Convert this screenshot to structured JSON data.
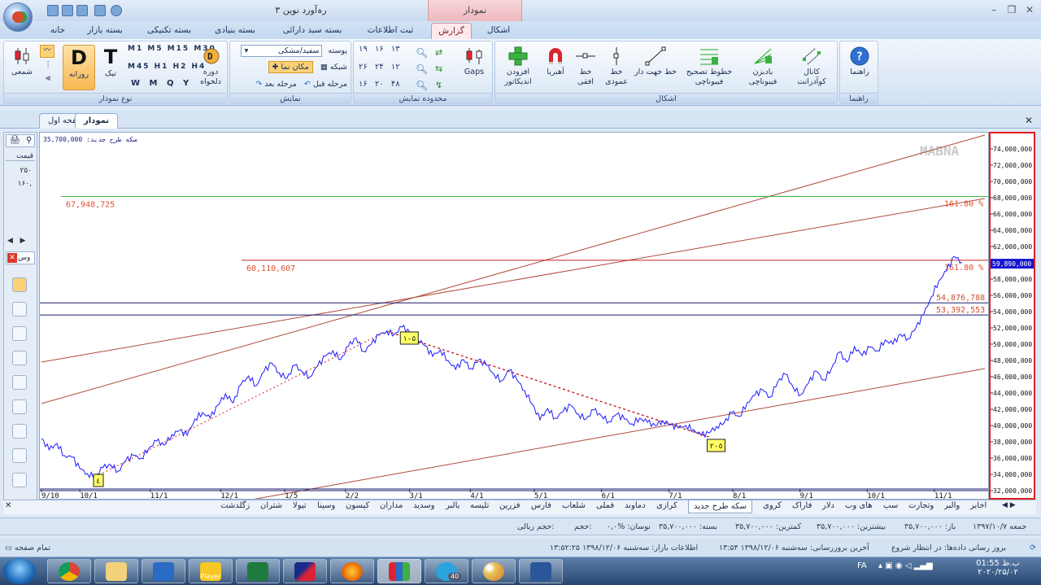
{
  "window": {
    "title": "رہ‌آورد نوین ۳",
    "context_tab_title": "نمودار"
  },
  "ribbon_tabs": [
    {
      "label": "خانه",
      "active": false
    },
    {
      "label": "بسته بازار",
      "active": false
    },
    {
      "label": "بسته تکنیکی",
      "active": false
    },
    {
      "label": "بسته بنیادی",
      "active": false
    },
    {
      "label": "بسته سبد دارائی",
      "active": false
    },
    {
      "label": "ثبت اطلاعات",
      "active": false
    },
    {
      "label": "گزارش",
      "active": true
    },
    {
      "label": "اشکال",
      "active": false
    }
  ],
  "groups": {
    "chart_type": {
      "label": "نوع نمودار",
      "candle": "شمعی",
      "daily": "روزانه",
      "tick": "تیک",
      "period": "دوره دلخواه",
      "period_letters": {
        "m1": "M1",
        "m5": "M5",
        "m15": "M15",
        "m30": "M30",
        "m45": "M45",
        "h1": "H1",
        "h2": "H2",
        "h4": "H4",
        "w": "W",
        "mo": "M",
        "q": "Q",
        "y": "Y"
      },
      "big_d": "D",
      "big_t": "T"
    },
    "view": {
      "label": "نمایش",
      "skin_label": "پوسته",
      "skin_value": "سفید/مشکی",
      "grid": "شبکه",
      "cursor": "مکان نما",
      "prev": "مرحله قبل",
      "next": "مرحله بعد"
    },
    "range": {
      "label": "محدوده نمایش",
      "row1": [
        "۱۹",
        "۱۶",
        "۱۳"
      ],
      "row2": [
        "۲۶",
        "۲۴",
        "۱۲"
      ],
      "row3": [
        "۱۶",
        "۲۰",
        "۴۸"
      ],
      "gaps": "Gaps"
    },
    "shapes": {
      "label": "اشکال",
      "add_indicator": "افزودن اندیکاتور",
      "magnet": "آهنربا",
      "hline": "خط افقی",
      "vline": "خط عمودی",
      "trend": "خط جهت دار",
      "fib_retr": "خطوط تصحیح فیبوناچی",
      "fib_fan": "بادبزن فیبوناچی",
      "channel": "کانال کوآدرانت"
    },
    "help": {
      "label": "راهنما",
      "button": "راهنما"
    }
  },
  "doc_tabs": [
    {
      "label": "نمودار",
      "active": true
    },
    {
      "label": "صفحه اول",
      "active": false
    }
  ],
  "left_panel": {
    "header": "قیمت",
    "rows": [
      "۲۵۰",
      "۱۶۰,"
    ],
    "search_label": "وس"
  },
  "chart_data": {
    "type": "line",
    "symbol_label": "سکه طرح جدید: 35,700,000",
    "watermark": "MABNA",
    "x_ticks": [
      "9/10",
      "10/1",
      "11/1",
      "12/1",
      "1/5",
      "2/2",
      "3/1",
      "4/1",
      "5/1",
      "6/1",
      "7/1",
      "8/1",
      "9/1",
      "10/1",
      "11/1",
      "12/1"
    ],
    "y_ticks": [
      "74,000,000",
      "72,000,000",
      "70,000,000",
      "68,000,000",
      "66,000,000",
      "64,000,000",
      "62,000,000",
      "60,000,000",
      "58,000,000",
      "56,000,000",
      "54,000,000",
      "52,000,000",
      "50,000,000",
      "48,000,000",
      "46,000,000",
      "44,000,000",
      "42,000,000",
      "40,000,000",
      "38,000,000",
      "36,000,000",
      "34,000,000",
      "32,000,000"
    ],
    "ylim": [
      30800000,
      75800000
    ],
    "last_price": "59,890,000",
    "series_color": "#1a1aff",
    "price_series": [
      [
        0,
        38200000
      ],
      [
        2,
        36800000
      ],
      [
        4,
        37600000
      ],
      [
        6,
        36100000
      ],
      [
        8,
        35900000
      ],
      [
        10,
        34500000
      ],
      [
        12,
        33900000
      ],
      [
        14,
        33500000
      ],
      [
        16,
        34600000
      ],
      [
        18,
        35000000
      ],
      [
        20,
        34200000
      ],
      [
        22,
        35500000
      ],
      [
        24,
        36100000
      ],
      [
        26,
        35800000
      ],
      [
        28,
        37000000
      ],
      [
        30,
        37900000
      ],
      [
        32,
        37400000
      ],
      [
        34,
        38700000
      ],
      [
        36,
        39200000
      ],
      [
        38,
        38600000
      ],
      [
        40,
        40600000
      ],
      [
        42,
        41400000
      ],
      [
        44,
        40700000
      ],
      [
        46,
        42300000
      ],
      [
        48,
        43700000
      ],
      [
        50,
        42600000
      ],
      [
        52,
        44800000
      ],
      [
        54,
        45900000
      ],
      [
        56,
        44700000
      ],
      [
        58,
        46400000
      ],
      [
        60,
        47500000
      ],
      [
        62,
        46300000
      ],
      [
        64,
        45600000
      ],
      [
        66,
        47200000
      ],
      [
        68,
        46400000
      ],
      [
        70,
        45800000
      ],
      [
        72,
        47100000
      ],
      [
        74,
        48300000
      ],
      [
        76,
        49000000
      ],
      [
        78,
        47900000
      ],
      [
        80,
        49500000
      ],
      [
        82,
        50600000
      ],
      [
        84,
        48900000
      ],
      [
        86,
        49800000
      ],
      [
        88,
        50900000
      ],
      [
        90,
        51400000
      ],
      [
        92,
        51000000
      ],
      [
        94,
        51900000
      ],
      [
        96,
        51300000
      ],
      [
        98,
        50500000
      ],
      [
        100,
        49600000
      ],
      [
        102,
        48300000
      ],
      [
        104,
        49100000
      ],
      [
        106,
        47800000
      ],
      [
        108,
        46700000
      ],
      [
        110,
        47900000
      ],
      [
        112,
        46800000
      ],
      [
        114,
        47900000
      ],
      [
        116,
        47200000
      ],
      [
        118,
        46100000
      ],
      [
        120,
        45300000
      ],
      [
        122,
        46600000
      ],
      [
        124,
        45400000
      ],
      [
        126,
        44100000
      ],
      [
        128,
        42400000
      ],
      [
        130,
        40500000
      ],
      [
        132,
        41900000
      ],
      [
        134,
        40700000
      ],
      [
        136,
        41500000
      ],
      [
        138,
        42300000
      ],
      [
        140,
        41200000
      ],
      [
        142,
        40600000
      ],
      [
        144,
        41700000
      ],
      [
        146,
        41000000
      ],
      [
        148,
        40300000
      ],
      [
        150,
        41200000
      ],
      [
        152,
        40600000
      ],
      [
        154,
        40000000
      ],
      [
        156,
        40700000
      ],
      [
        158,
        40200000
      ],
      [
        160,
        39800000
      ],
      [
        162,
        40400000
      ],
      [
        164,
        39900000
      ],
      [
        166,
        39500000
      ],
      [
        168,
        39800000
      ],
      [
        170,
        39300000
      ],
      [
        172,
        38600000
      ],
      [
        174,
        38900000
      ],
      [
        176,
        39700000
      ],
      [
        178,
        40100000
      ],
      [
        180,
        41400000
      ],
      [
        182,
        40900000
      ],
      [
        184,
        42600000
      ],
      [
        186,
        43500000
      ],
      [
        188,
        44200000
      ],
      [
        190,
        43300000
      ],
      [
        192,
        45200000
      ],
      [
        194,
        46100000
      ],
      [
        196,
        44500000
      ],
      [
        198,
        43600000
      ],
      [
        200,
        45000000
      ],
      [
        202,
        46500000
      ],
      [
        204,
        45400000
      ],
      [
        206,
        46800000
      ],
      [
        208,
        48800000
      ],
      [
        210,
        47600000
      ],
      [
        212,
        49500000
      ],
      [
        214,
        48400000
      ],
      [
        216,
        49400000
      ],
      [
        218,
        49000000
      ],
      [
        220,
        50300000
      ],
      [
        222,
        49800000
      ],
      [
        224,
        51000000
      ],
      [
        226,
        50500000
      ],
      [
        228,
        51800000
      ],
      [
        230,
        53400000
      ],
      [
        232,
        55600000
      ],
      [
        234,
        57600000
      ],
      [
        236,
        58800000
      ],
      [
        238,
        60600000
      ],
      [
        240,
        59890000
      ]
    ],
    "horizontal_lines": [
      {
        "value": 67948725,
        "label": "67,948,725",
        "fib": "161.80 %",
        "color": "#3cba3c"
      },
      {
        "value": 60110607,
        "label": "60,110,607",
        "fib": "161.80 %",
        "color": "#c42020"
      },
      {
        "value": 54876788,
        "label": "54,876,788",
        "color": "#1a1a6e"
      },
      {
        "value": 53392553,
        "label": "53,392,553",
        "color": "#1a1a6e"
      },
      {
        "value": 31800000,
        "label": "",
        "color": "#1a1a6e"
      }
    ],
    "wave_labels": [
      {
        "text": "٤",
        "x": 14,
        "price": 33000000
      },
      {
        "text": "٥-١",
        "x": 94,
        "price": 50500000
      },
      {
        "text": "٥-٢",
        "x": 174,
        "price": 37300000
      }
    ]
  },
  "sheet_tabs": [
    "اخابر",
    "والبر",
    "وتجارت",
    "سپ",
    "های وب",
    "دلار",
    "فاراک",
    "کروی",
    "سکه طرح جدید",
    "کرازی",
    "دماوند",
    "فملی",
    "شلعاب",
    "فارس",
    "فزرین",
    "تلیسه",
    "بالبر",
    "وسدید",
    "مداران",
    "کیسون",
    "وسینا",
    "تیولا",
    "شتران",
    "زگلدشت"
  ],
  "active_sheet": "سکه طرح جدید",
  "status_line1": [
    "جمعه ۱۳۹۷/۱۰/۷",
    "باز: ۳۵,۷۰۰,۰۰۰",
    "بیشترین: ۳۵,۷۰۰,۰۰۰",
    "کمترین: ۳۵,۷۰۰,۰۰۰",
    "بسته: ۳۵,۷۰۰,۰۰۰",
    "نوسان: %۰,۰",
    "حجم:",
    "حجم ریالی:"
  ],
  "status_line2": {
    "update": "بروز رسانی داده‌ها: در انتظار شروع",
    "last_update": "آخرین بروزرسانی: سه‌شنبه ۱۳۹۸/۱۲/۰۶ ۱۳:۵۴",
    "market_info": "اطلاعات بازار: سه‌شنبه ۱۳۹۸/۱۲/۰۶ ۱۳:۵۲:۲۵",
    "fullscreen": "تمام صفحه"
  },
  "taskbar": {
    "apps": [
      "chrome-icon",
      "explorer-icon",
      "media-icon",
      "player-icon",
      "excel-icon",
      "chart-app-icon",
      "firefox-icon",
      "office-icon",
      "telegram-icon",
      "paint-icon",
      "word-icon"
    ],
    "player_label": "Player",
    "telegram_badge": "40",
    "lang": "FA",
    "time": "01:55 ب.ظ",
    "date": "۲۰۲۰/۲۵/۰۲"
  }
}
